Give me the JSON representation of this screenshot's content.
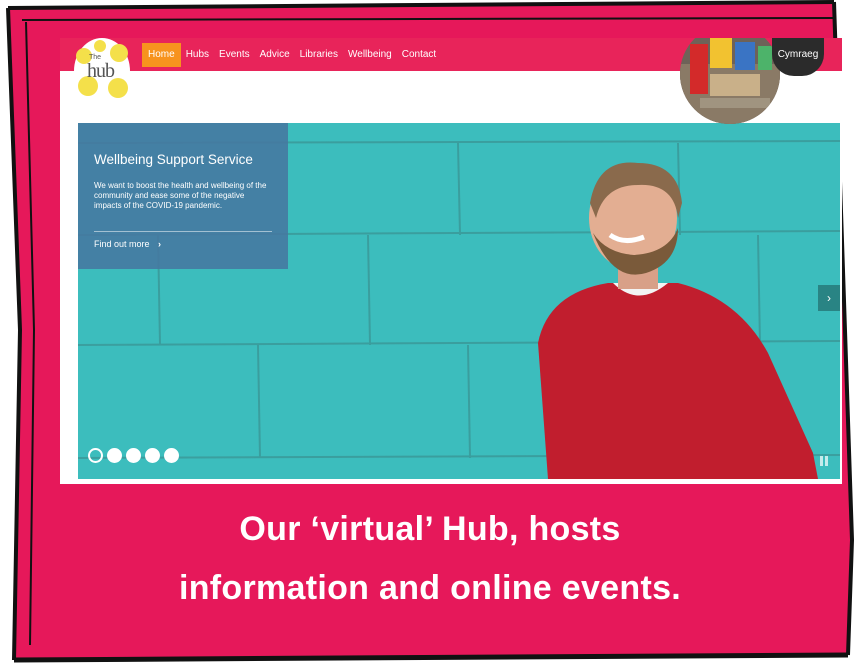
{
  "site": {
    "logo_text": "hub",
    "logo_small": "The",
    "nav": [
      {
        "label": "Home",
        "active": true
      },
      {
        "label": "Hubs"
      },
      {
        "label": "Events"
      },
      {
        "label": "Advice"
      },
      {
        "label": "Libraries"
      },
      {
        "label": "Wellbeing"
      },
      {
        "label": "Contact"
      }
    ],
    "language_button": "Cymraeg",
    "nav_color": "#e8245a",
    "active_color": "#f7931e"
  },
  "hero": {
    "title": "Wellbeing Support Service",
    "text": "We want to boost the health and wellbeing of the community and ease some of the negative impacts of the COVID-19 pandemic.",
    "link": "Find out more",
    "next": "›",
    "slide_count": 5,
    "active_slide": 1
  },
  "caption": {
    "line1": "Our ‘virtual’ Hub, hosts",
    "line2": "information and online events."
  },
  "colors": {
    "slide_background": "#e6185a",
    "hero_background": "#3fbcbc",
    "panel": "#46789f"
  }
}
